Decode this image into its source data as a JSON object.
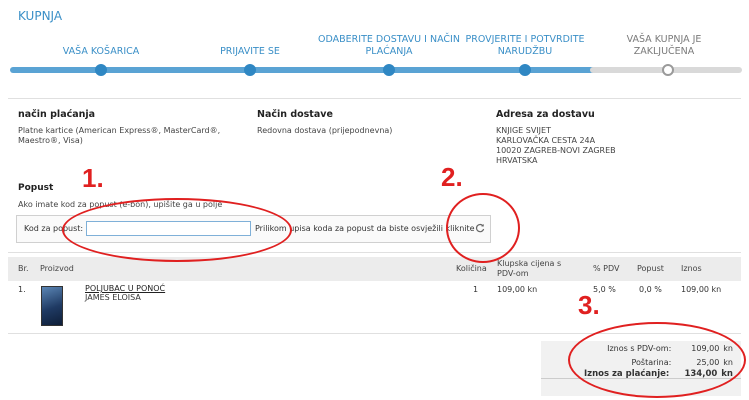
{
  "header": {
    "title": "KUPNJA"
  },
  "steps": [
    {
      "label": "VAŠA KOŠARICA"
    },
    {
      "label": "PRIJAVITE SE"
    },
    {
      "label_line1": "ODABERITE DOSTAVU I NAČIN",
      "label_line2": "PLAĆANJA"
    },
    {
      "label_line1": "PROVJERITE I POTVRDITE",
      "label_line2": "NARUDŽBU"
    },
    {
      "label_line1": "VAŠA KUPNJA JE",
      "label_line2": "ZAKLJUČENA"
    }
  ],
  "info": {
    "payment": {
      "title": "način plaćanja",
      "line1": "Platne kartice (American Express®, MasterCard®,",
      "line2": "Maestro®, Visa)"
    },
    "delivery": {
      "title": "Način dostave",
      "line1": "Redovna dostava (prijepodnevna)"
    },
    "address": {
      "title": "Adresa za dostavu",
      "line1": "KNJIGE SVIJET",
      "line2": "KARLOVAČKA CESTA 24A",
      "line3": "10020 ZAGREB-NOVI ZAGREB",
      "line4": "HRVATSKA"
    }
  },
  "discount": {
    "title": "Popust",
    "hint": "Ako imate kod za popust (e-bon), upišite ga u polje",
    "field_label": "Kod za popust:",
    "field_value": "",
    "note": "Prilikom upisa koda za popust da biste osvježili kliknite"
  },
  "table": {
    "headers": {
      "no": "Br.",
      "product": "Proizvod",
      "qty": "Količina",
      "price_line1": "Klupska cijena s",
      "price_line2": "PDV-om",
      "vat_pct": "% PDV",
      "discount": "Popust",
      "amount": "Iznos"
    },
    "rows": [
      {
        "no": "1.",
        "title": "POLJUBAC U PONOĆ",
        "author": "JAMES ELOISA",
        "qty": "1",
        "price": "109,00 kn",
        "vat_pct": "5,0 %",
        "discount": "0,0 %",
        "amount": "109,00 kn"
      }
    ]
  },
  "totals": {
    "with_vat_label": "Iznos s PDV-om:",
    "with_vat_value": "109,00",
    "with_vat_unit": "kn",
    "shipping_label": "Poštarina:",
    "shipping_value": "25,00",
    "shipping_unit": "kn",
    "total_label": "Iznos za plaćanje:",
    "total_value": "134,00",
    "total_unit": "kn"
  },
  "annotations": {
    "n1": "1.",
    "n2": "2.",
    "n3": "3."
  },
  "colors": {
    "accent": "#3a8fc7",
    "annotation": "#e02020"
  }
}
